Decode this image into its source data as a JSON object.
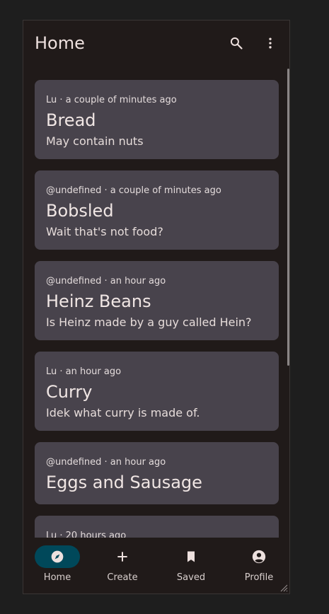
{
  "appbar": {
    "title": "Home",
    "icons": [
      "search-icon",
      "more-vert-icon"
    ]
  },
  "posts": [
    {
      "meta": "Lu · a couple of minutes ago",
      "title": "Bread",
      "body": "May contain nuts"
    },
    {
      "meta": "@undefined · a couple of minutes ago",
      "title": "Bobsled",
      "body": "Wait that's not food?"
    },
    {
      "meta": "@undefined · an hour ago",
      "title": "Heinz Beans",
      "body": "Is Heinz made by a guy called Hein?"
    },
    {
      "meta": "Lu · an hour ago",
      "title": "Curry",
      "body": "Idek what curry is made of."
    },
    {
      "meta": "@undefined · an hour ago",
      "title": "Eggs and Sausage",
      "body": ""
    },
    {
      "meta": "Lu · 20 hours ago",
      "title": "",
      "body": ""
    }
  ],
  "nav": {
    "items": [
      {
        "label": "Home",
        "icon": "compass-icon",
        "active": true
      },
      {
        "label": "Create",
        "icon": "plus-icon",
        "active": false
      },
      {
        "label": "Saved",
        "icon": "bookmark-icon",
        "active": false
      },
      {
        "label": "Profile",
        "icon": "account-circle-icon",
        "active": false
      }
    ]
  },
  "colors": {
    "background": "#201a19",
    "card": "#48434c",
    "nav_active": "#00485a",
    "text": "#ede0de"
  }
}
